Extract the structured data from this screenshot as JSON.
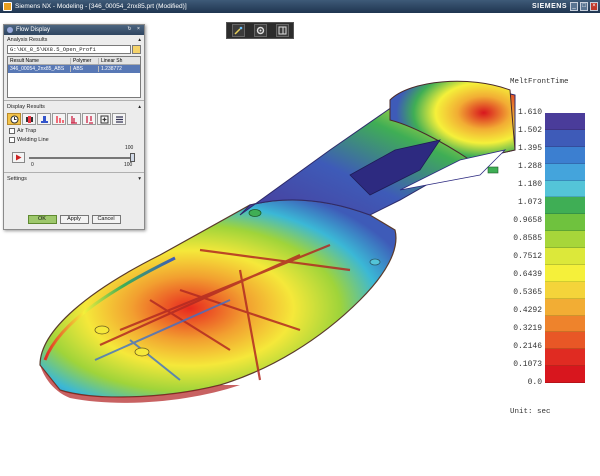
{
  "window": {
    "title": "Siemens NX - Modeling - [346_00054_2nx85.prt (Modified)]",
    "brand": "SIEMENS",
    "min_label": "_",
    "max_label": "□",
    "close_label": "×"
  },
  "toolbar": {
    "icons": [
      "magic-wand-icon",
      "gear-icon",
      "window-layout-icon"
    ]
  },
  "dialog": {
    "title": "Flow Display",
    "reset_label": "↻",
    "close_label": "×",
    "analysis_results": {
      "heading": "Analysis Results",
      "path_value": "G:\\NX_8_5\\NX8.5_Open_Profi",
      "columns": [
        "Result Name",
        "Polymer",
        "Linear Sh"
      ],
      "rows": [
        {
          "name": "346_00054_2nx85_ABS",
          "polymer": "ABS",
          "linear": "1.238772"
        }
      ]
    },
    "display_results": {
      "heading": "Display Results",
      "air_trap_label": "Air Trap",
      "welding_line_label": "Welding Line",
      "slider_min": "0",
      "slider_max": "100",
      "slider_top": "100",
      "slider_value": 100
    },
    "settings": {
      "heading": "Settings"
    },
    "buttons": {
      "ok": "OK",
      "apply": "Apply",
      "cancel": "Cancel"
    }
  },
  "legend": {
    "title": "MeltFrontTime",
    "unit": "Unit: sec",
    "values": [
      "1.610",
      "1.502",
      "1.395",
      "1.288",
      "1.180",
      "1.073",
      "0.9658",
      "0.8585",
      "0.7512",
      "0.6439",
      "0.5365",
      "0.4292",
      "0.3219",
      "0.2146",
      "0.1073",
      "0.0"
    ],
    "colors": [
      "#4a3c9a",
      "#3e5bb8",
      "#3c7fd0",
      "#44a4dc",
      "#54c4d8",
      "#3fae55",
      "#6fc23e",
      "#a7d63a",
      "#dce83a",
      "#f5f03a",
      "#f4d43a",
      "#f2ad34",
      "#ee832c",
      "#e85726",
      "#e02b22",
      "#d8161e"
    ]
  }
}
